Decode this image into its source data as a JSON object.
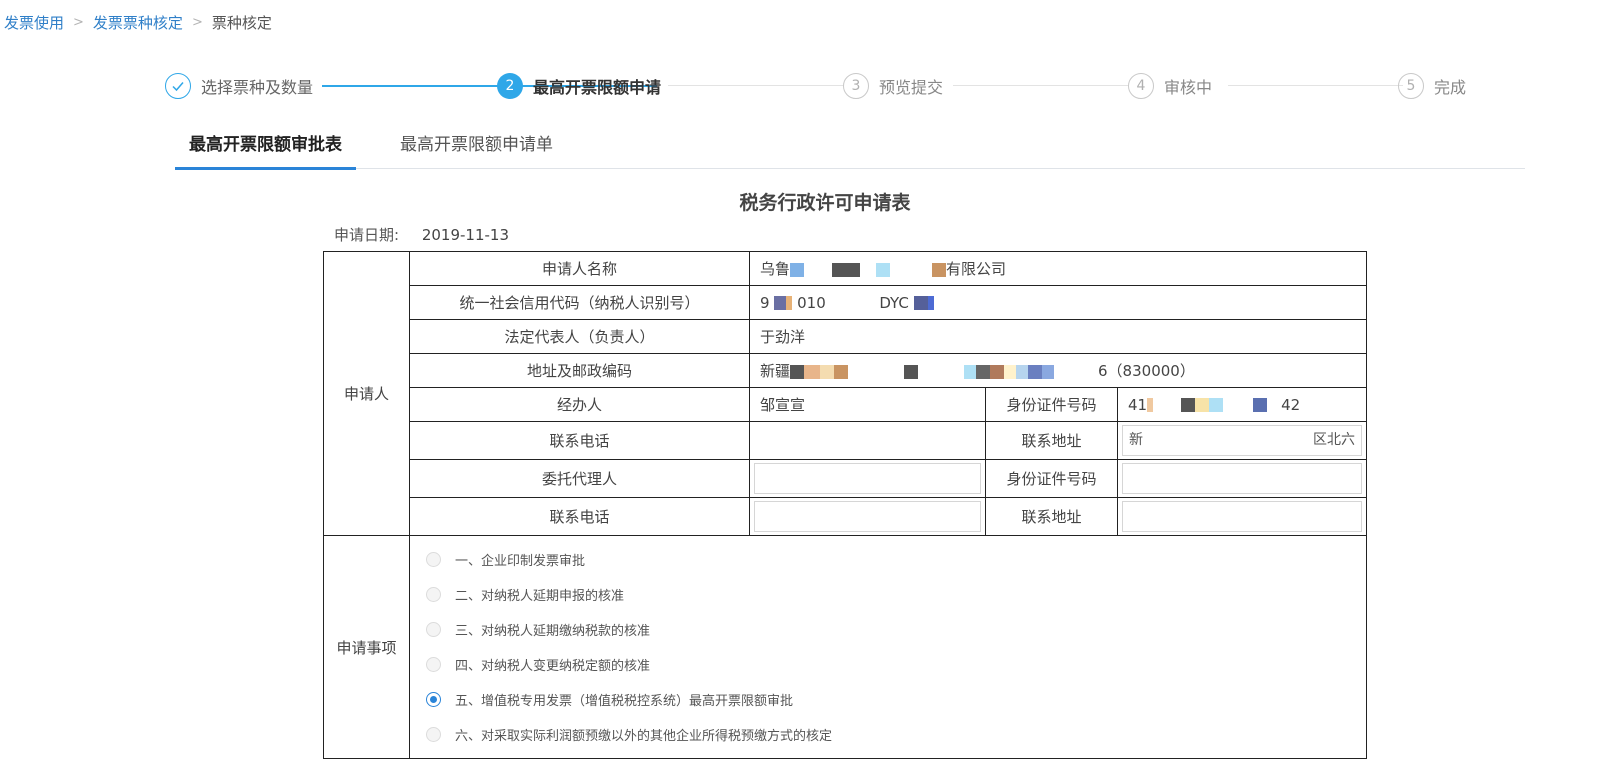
{
  "breadcrumb": {
    "items": [
      "发票使用",
      "发票票种核定",
      "票种核定"
    ],
    "separator": ">"
  },
  "steps": [
    {
      "number": "✓",
      "label": "选择票种及数量",
      "state": "done"
    },
    {
      "number": "2",
      "label": "最高开票限额申请",
      "state": "active"
    },
    {
      "number": "3",
      "label": "预览提交",
      "state": "pending"
    },
    {
      "number": "4",
      "label": "审核中",
      "state": "pending"
    },
    {
      "number": "5",
      "label": "完成",
      "state": "pending"
    }
  ],
  "tabs": [
    {
      "label": "最高开票限额审批表",
      "active": true
    },
    {
      "label": "最高开票限额申请单",
      "active": false
    }
  ],
  "form": {
    "title": "税务行政许可申请表",
    "date_label": "申请日期:",
    "date_value": "2019-11-13",
    "applicant_section": "申请人",
    "rows": {
      "name_label": "申请人名称",
      "name_value_prefix": "乌鲁",
      "name_value_suffix": "有限公司",
      "credit_label": "统一社会信用代码（纳税人识别号）",
      "credit_value_a": "9",
      "credit_value_b": "010",
      "credit_value_c": "DYC",
      "legal_label": "法定代表人（负责人）",
      "legal_value": "于劲洋",
      "address_label": "地址及邮政编码",
      "address_value_prefix": "新疆",
      "address_value_suffix": "6（830000）",
      "handler_label": "经办人",
      "handler_value": "邹宣宣",
      "id_label": "身份证件号码",
      "id_value_prefix": "41",
      "id_value_suffix": "42",
      "phone_label": "联系电话",
      "contact_addr_label": "联系地址",
      "contact_addr_value_prefix": "新",
      "contact_addr_value_suffix": "区北六",
      "agent_label": "委托代理人",
      "agent_id_label": "身份证件号码",
      "agent_phone_label": "联系电话",
      "agent_addr_label": "联系地址"
    },
    "matters_section": "申请事项",
    "matters": [
      {
        "label": "一、企业印制发票审批",
        "checked": false
      },
      {
        "label": "二、对纳税人延期申报的核准",
        "checked": false
      },
      {
        "label": "三、对纳税人延期缴纳税款的核准",
        "checked": false
      },
      {
        "label": "四、对纳税人变更纳税定额的核准",
        "checked": false
      },
      {
        "label": "五、增值税专用发票（增值税税控系统）最高开票限额审批",
        "checked": true
      },
      {
        "label": "六、对采取实际利润额预缴以外的其他企业所得税预缴方式的核定",
        "checked": false
      }
    ]
  },
  "colors": {
    "accent": "#2fa7e8",
    "link": "#2f7fc8",
    "tab_underline": "#2a84d8",
    "table_border": "#222222"
  }
}
